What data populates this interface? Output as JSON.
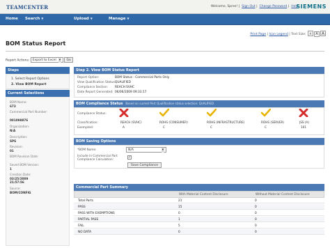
{
  "header": {
    "logo": "TEAMCENTER",
    "welcome_text": "Welcome, Spree!",
    "sign_out": "Sign Out",
    "change_password": "Change Password",
    "help": "Help",
    "brand": "SIEMENS"
  },
  "menu": [
    {
      "label": "Home"
    },
    {
      "label": "Search",
      "caret": "▼"
    },
    {
      "label": "Upload",
      "caret": "▼"
    },
    {
      "label": "Manage",
      "caret": "▼"
    }
  ],
  "page_tools": {
    "print_page": "Print Page",
    "icon_legend": "Icon Legend",
    "text_size_label": "Text Size:",
    "sizes": [
      "A",
      "A",
      "A"
    ]
  },
  "page_title": "BOM Status Report",
  "report_actions": {
    "label": "Report Actions:",
    "selected": "Export to Excel",
    "go": "Go"
  },
  "sidebar": {
    "steps_title": "Steps",
    "steps": [
      "1. Select Report Options",
      "2. View BOM Report"
    ],
    "selections_title": "Current Selections",
    "fields": [
      {
        "label": "BOM Name:",
        "value": "673"
      },
      {
        "label": "Commercial Part Number:",
        "value": "001098876"
      },
      {
        "label": "Organization:",
        "value": "N/A"
      },
      {
        "label": "Description:",
        "value": "SPS"
      },
      {
        "label": "Revision:",
        "value": "01"
      },
      {
        "label": "BOM Revision Date:",
        "value": ""
      },
      {
        "label": "Saved BOM Version:",
        "value": "1"
      },
      {
        "label": "Creation Date:",
        "value": "03/25/2009 21:57:56"
      },
      {
        "label": "Source:",
        "value": "BOM/CONFIG"
      }
    ]
  },
  "step_view": {
    "title": "Step 2. View BOM Status Report",
    "rows": [
      {
        "label": "Report Option:",
        "value": "BOM Status - Commercial Parts Only"
      },
      {
        "label": "View Qualification Status:",
        "value": "QUALIFIED"
      },
      {
        "label": "Compliance Section:",
        "value": "REACH SVHC"
      },
      {
        "label": "Date Report Generated:",
        "value": "06/06/2009 09:33:17"
      }
    ]
  },
  "compliance": {
    "title": "BOM Compliance Status",
    "note": "Based on current Part Qualification status selection: QUALIFIED",
    "status_label": "Compliance Status:",
    "classification_label": "Classification:",
    "grade_label": "Exempted:",
    "items": [
      {
        "name": "REACH (SVHC)",
        "grade": "A",
        "status": "fail"
      },
      {
        "name": "ROHS (CONSUMER)",
        "grade": "C",
        "status": "pass"
      },
      {
        "name": "ROHS (INFRASTRUCTURE)",
        "grade": "C",
        "status": "pass"
      },
      {
        "name": "ROHS (SERVER)",
        "grade": "C",
        "status": "pass"
      },
      {
        "name": "JSS (A)",
        "grade": "101",
        "status": "fail"
      }
    ]
  },
  "saving": {
    "title": "BOM Saving Options",
    "bom_name_label": "*BOM Name:",
    "bom_name_value": "N/A",
    "include_label": "Include in Commercial Part Compliance Calculation:",
    "save_button": "Save Compliance"
  },
  "summary": {
    "title": "Commercial Part Summary",
    "col_headers": [
      "",
      "With Material Content Disclosure",
      "Without Material Content Disclosure"
    ],
    "rows": [
      {
        "label": "Total Parts",
        "with": "21",
        "without": "0"
      },
      {
        "label": "PASS",
        "with": "15",
        "without": "0"
      },
      {
        "label": "PASS WITH EXEMPTIONS",
        "with": "0",
        "without": "0"
      },
      {
        "label": "PARTIAL PASS",
        "with": "1",
        "without": "0"
      },
      {
        "label": "FAIL",
        "with": "5",
        "without": "0"
      },
      {
        "label": "NO DATA",
        "with": "0",
        "without": "0"
      }
    ]
  },
  "colors": {
    "menu_bar": "#2f68a8",
    "section_header": "#4a79b4",
    "pass_check": "#e8b400",
    "fail_x": "#d52b2b"
  }
}
